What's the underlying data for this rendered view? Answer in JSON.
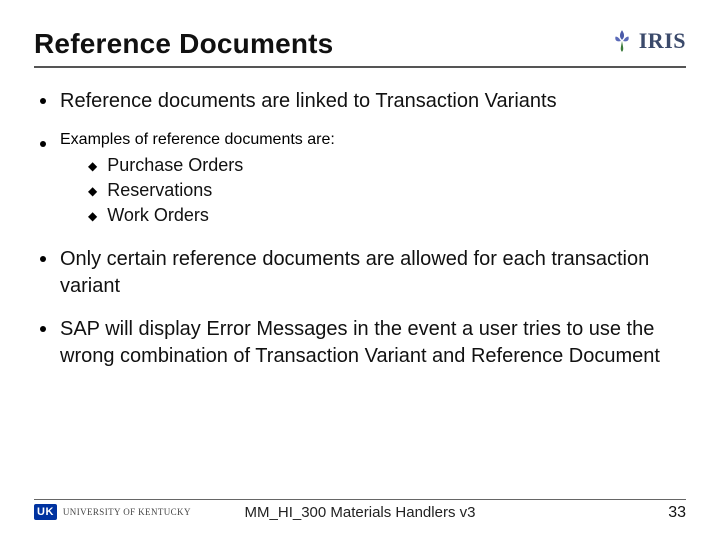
{
  "header": {
    "title": "Reference Documents",
    "logo_text": "IRIS"
  },
  "bullets": [
    {
      "text": "Reference documents are linked to Transaction Variants",
      "subs": []
    },
    {
      "text": "Examples of reference documents are:",
      "subs": [
        "Purchase Orders",
        "Reservations",
        "Work Orders"
      ]
    },
    {
      "text": "Only certain reference documents are allowed for each transaction variant",
      "subs": []
    },
    {
      "text": "SAP will display Error Messages in the event a user tries to use the wrong combination of Transaction Variant and Reference Document",
      "subs": []
    }
  ],
  "footer": {
    "uk_badge": "UK",
    "uk_text": "UNIVERSITY OF KENTUCKY",
    "doc_title": "MM_HI_300 Materials Handlers v3",
    "page_number": "33"
  }
}
